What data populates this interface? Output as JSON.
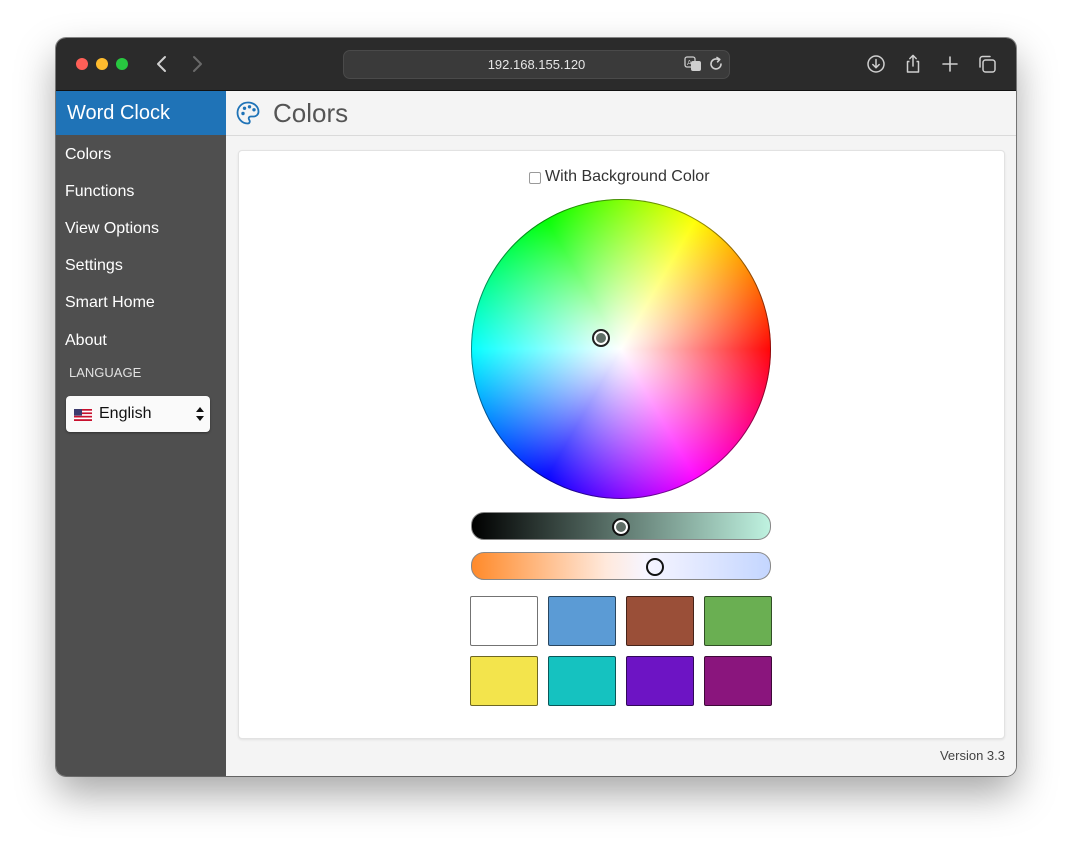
{
  "browser": {
    "url": "192.168.155.120"
  },
  "sidebar": {
    "brand": "Word Clock",
    "items": [
      {
        "label": "Colors"
      },
      {
        "label": "Functions"
      },
      {
        "label": "View Options"
      },
      {
        "label": "Settings"
      },
      {
        "label": "Smart Home"
      },
      {
        "label": "About"
      }
    ],
    "language_heading": "LANGUAGE",
    "language_selected": "English"
  },
  "main": {
    "title": "Colors",
    "background_option_label": "With Background Color",
    "background_option_checked": false,
    "brightness_level": 0.5,
    "temperature_level": 0.62,
    "swatches": [
      "#ffffff",
      "#5b9bd5",
      "#9a4f38",
      "#6aaf52",
      "#f3e44c",
      "#15c2c0",
      "#6d14c4",
      "#8a157d"
    ]
  },
  "footer": {
    "version": "Version 3.3"
  },
  "colors": {
    "brand": "#1f73b7",
    "sidebar": "#4f4f4f"
  }
}
